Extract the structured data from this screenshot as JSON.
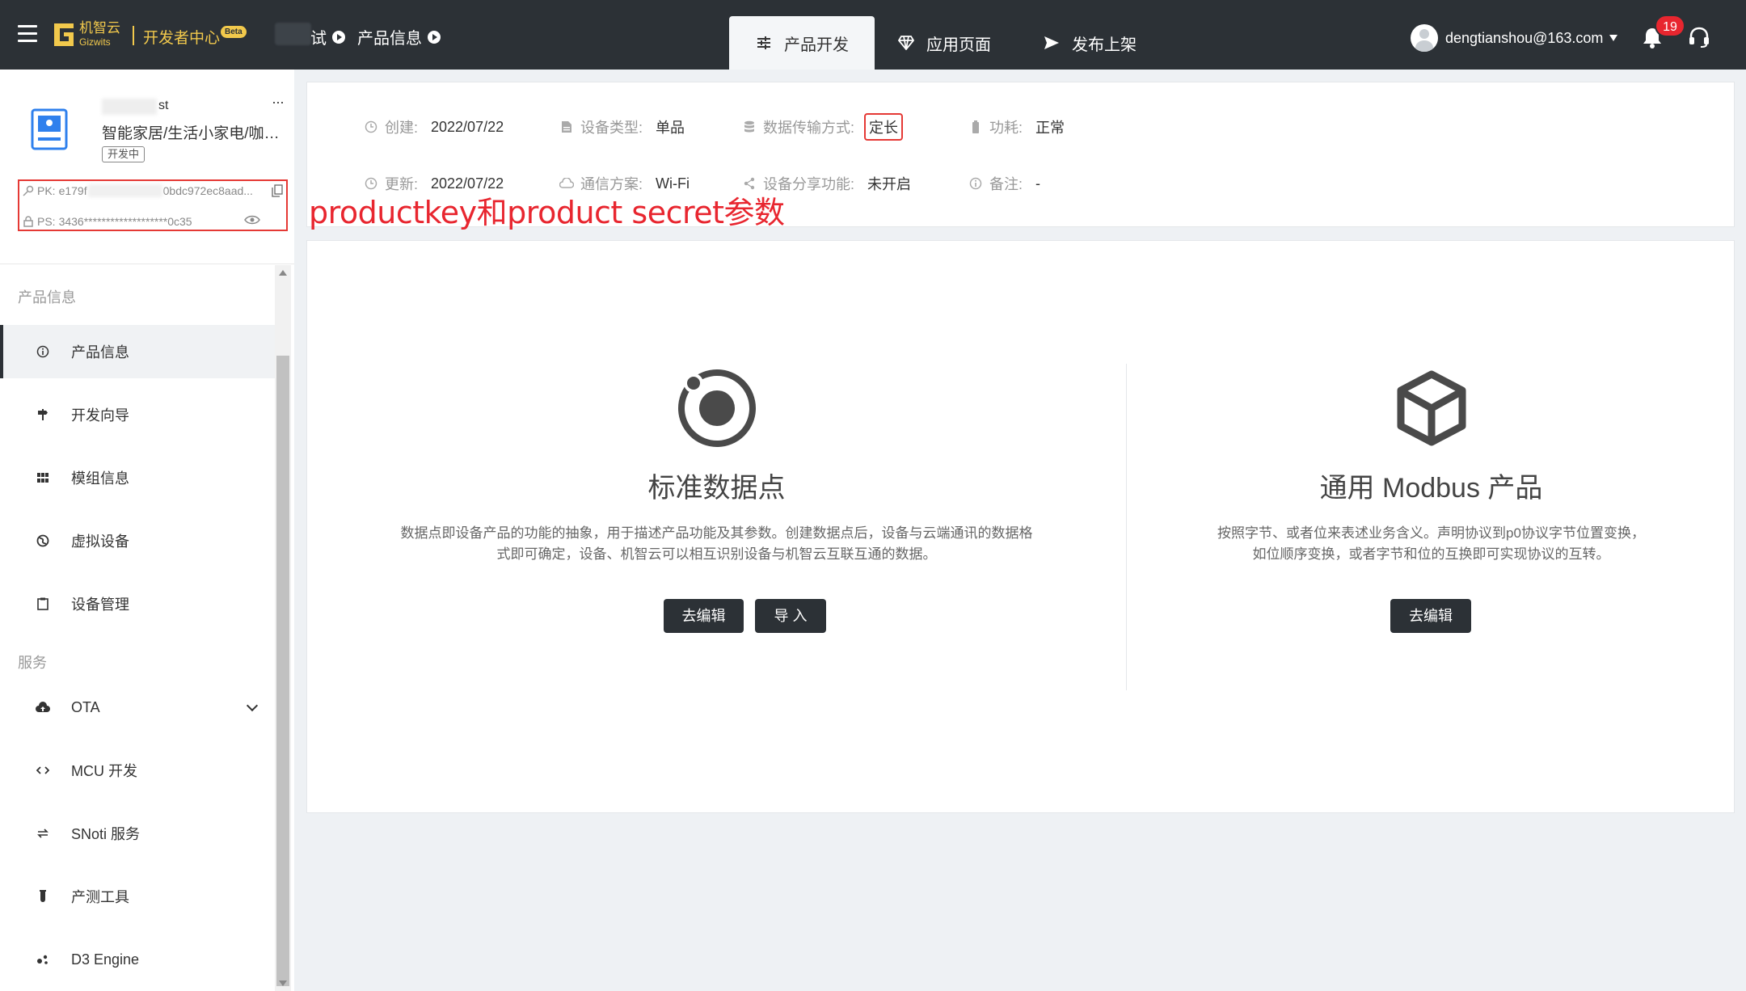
{
  "topbar": {
    "logo_cn": "机智云",
    "logo_en": "Gizwits",
    "dev_center": "开发者中心",
    "beta": "Beta",
    "breadcrumb": [
      "测试",
      "产品信息"
    ],
    "breadcrumb_visible_suffix": "试",
    "tabs": [
      {
        "label": "产品开发",
        "icon": "sliders-icon",
        "active": true
      },
      {
        "label": "应用页面",
        "icon": "diamond-icon",
        "active": false
      },
      {
        "label": "发布上架",
        "icon": "send-icon",
        "active": false
      }
    ],
    "user_email": "dengtianshou@163.com",
    "notification_count": "19"
  },
  "product": {
    "name_suffix": "st",
    "more": "···",
    "category": "智能家居/生活小家电/咖啡机",
    "status": "开发中",
    "pk_label": "PK:",
    "pk_prefix": "e179f",
    "pk_suffix": "0bdc972ec8aad...",
    "ps_label": "PS:",
    "ps_value": "3436*******************0c35"
  },
  "sidebar": {
    "section_product": "产品信息",
    "section_service": "服务",
    "items": [
      {
        "label": "产品信息",
        "icon": "info-icon",
        "active": true
      },
      {
        "label": "开发向导",
        "icon": "signpost-icon"
      },
      {
        "label": "模组信息",
        "icon": "grid-icon"
      },
      {
        "label": "虚拟设备",
        "icon": "globe-icon"
      },
      {
        "label": "设备管理",
        "icon": "clipboard-icon"
      },
      {
        "label": "OTA",
        "icon": "cloud-upload-icon"
      },
      {
        "label": "MCU 开发",
        "icon": "code-icon"
      },
      {
        "label": "SNoti 服务",
        "icon": "exchange-icon"
      },
      {
        "label": "产测工具",
        "icon": "test-tube-icon"
      },
      {
        "label": "D3 Engine",
        "icon": "nodes-icon"
      }
    ]
  },
  "info": {
    "created_label": "创建:",
    "created_value": "2022/07/22",
    "device_type_label": "设备类型:",
    "device_type_value": "单品",
    "transfer_label": "数据传输方式:",
    "transfer_value": "定长",
    "power_label": "功耗:",
    "power_value": "正常",
    "updated_label": "更新:",
    "updated_value": "2022/07/22",
    "comm_label": "通信方案:",
    "comm_value": "Wi-Fi",
    "share_label": "设备分享功能:",
    "share_value": "未开启",
    "note_label": "备注:",
    "note_value": "-"
  },
  "annotation": "productkey和product secret参数",
  "panels": {
    "standard": {
      "title": "标准数据点",
      "desc": "数据点即设备产品的功能的抽象，用于描述产品功能及其参数。创建数据点后，设备与云端通讯的数据格式即可确定，设备、机智云可以相互识别设备与机智云互联互通的数据。",
      "edit_button": "去编辑",
      "import_button": "导 入"
    },
    "modbus": {
      "title": "通用 Modbus 产品",
      "desc": "按照字节、或者位来表述业务含义。声明协议到p0协议字节位置变换，如位顺序变换，或者字节和位的互换即可实现协议的互转。",
      "edit_button": "去编辑"
    }
  }
}
